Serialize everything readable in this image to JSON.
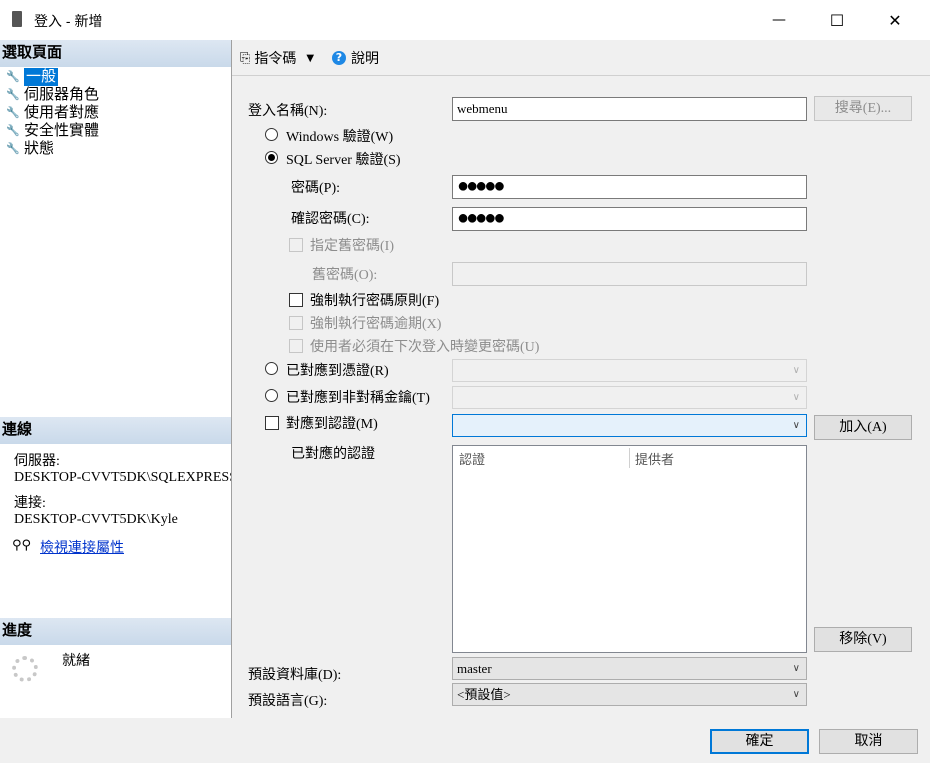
{
  "window": {
    "title": "登入 - 新增",
    "minimize": "—",
    "maximize": "☐",
    "close": "✕"
  },
  "left": {
    "select_page_header": "選取頁面",
    "pages": [
      "一般",
      "伺服器角色",
      "使用者對應",
      "安全性實體",
      "狀態"
    ],
    "connection_header": "連線",
    "server_label": "伺服器:",
    "server_value": "DESKTOP-CVVT5DK\\SQLEXPRESS",
    "conn_label": "連接:",
    "conn_value": "DESKTOP-CVVT5DK\\Kyle",
    "view_props_link": "檢視連接屬性",
    "progress_header": "進度",
    "progress_status": "就緒"
  },
  "toolbar": {
    "script_label": "指令碼",
    "help_label": "說明"
  },
  "form": {
    "login_name_label": "登入名稱(N):",
    "login_name_value": "webmenu",
    "search_button": "搜尋(E)...",
    "windows_auth_label": "Windows 驗證(W)",
    "sql_auth_label": "SQL Server 驗證(S)",
    "password_label": "密碼(P):",
    "password_value": "●●●●●",
    "confirm_password_label": "確認密碼(C):",
    "confirm_password_value": "●●●●●",
    "specify_old_password_label": "指定舊密碼(I)",
    "old_password_label": "舊密碼(O):",
    "enforce_policy_label": "強制執行密碼原則(F)",
    "enforce_expiration_label": "強制執行密碼逾期(X)",
    "must_change_label": "使用者必須在下次登入時變更密碼(U)",
    "map_cert_label": "已對應到憑證(R)",
    "map_asym_key_label": "已對應到非對稱金鑰(T)",
    "map_credential_label": "對應到認證(M)",
    "add_button": "加入(A)",
    "mapped_credentials_label": "已對應的認證",
    "credentials_columns": [
      "認證",
      "提供者"
    ],
    "remove_button": "移除(V)",
    "default_db_label": "預設資料庫(D):",
    "default_db_value": "master",
    "default_lang_label": "預設語言(G):",
    "default_lang_value": "<預設值>"
  },
  "footer": {
    "ok_button": "確定",
    "cancel_button": "取消"
  }
}
